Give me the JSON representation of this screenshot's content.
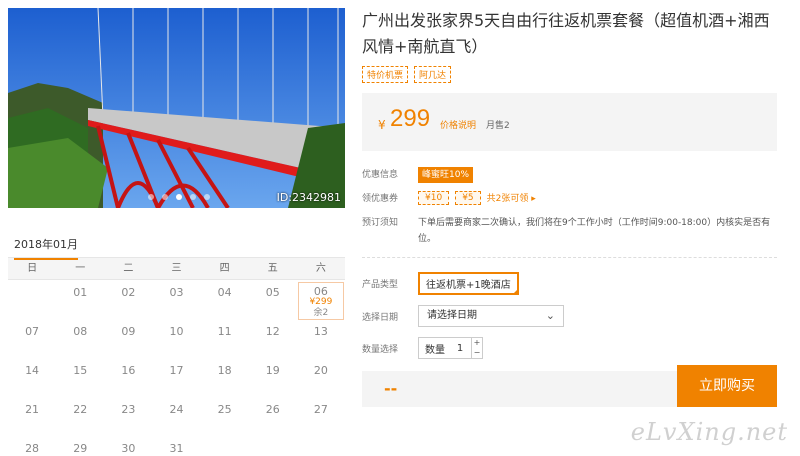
{
  "product": {
    "title": "广州出发张家界5天自由行往返机票套餐（超值机酒+湘西风情+南航直飞）",
    "tags": [
      "特价机票",
      "阿几达"
    ],
    "image_id": "ID:2342981",
    "carousel_count": 5
  },
  "price": {
    "currency": "¥",
    "amount": "299",
    "explain": "价格说明",
    "sold": "月售2"
  },
  "info": {
    "discount_label": "优惠信息",
    "discount_badge": "峰蜜旺10%",
    "coupon_label": "领优惠券",
    "coupons": [
      "¥10",
      "¥5"
    ],
    "coupon_link": "共2张可领 ▸",
    "notice_label": "预订须知",
    "notice_text": "下单后需要商家二次确认，我们将在9个工作小时（工作时间9:00-18:00）内核实是否有位。"
  },
  "options": {
    "type_label": "产品类型",
    "type_value": "往返机票+1晚酒店",
    "date_label": "选择日期",
    "date_placeholder": "请选择日期",
    "qty_label": "数量选择",
    "qty_text": "数量",
    "qty_value": "1"
  },
  "buy": {
    "total": "--",
    "button": "立即购买"
  },
  "calendar": {
    "month": "2018年01月",
    "weekdays": [
      "日",
      "一",
      "二",
      "三",
      "四",
      "五",
      "六"
    ],
    "weeks": [
      [
        "",
        "01",
        "02",
        "03",
        "04",
        "05",
        "06"
      ],
      [
        "07",
        "08",
        "09",
        "10",
        "11",
        "12",
        "13"
      ],
      [
        "14",
        "15",
        "16",
        "17",
        "18",
        "19",
        "20"
      ],
      [
        "21",
        "22",
        "23",
        "24",
        "25",
        "26",
        "27"
      ],
      [
        "28",
        "29",
        "30",
        "31",
        "",
        "",
        ""
      ]
    ],
    "available": {
      "day": "06",
      "price": "¥299",
      "remaining": "余2"
    }
  },
  "watermark": "eLvXing.net",
  "colors": {
    "accent": "#f08200",
    "bridge": "#e01b1b",
    "sky": "#2a6fd8"
  }
}
